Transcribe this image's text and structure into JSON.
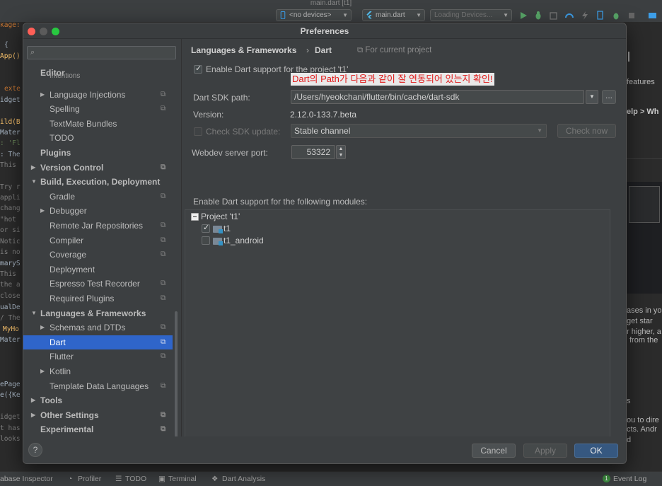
{
  "ide": {
    "window_title": "main.dart [t1]",
    "toolbar": {
      "device_combo": "<no devices>",
      "file_combo": "main.dart",
      "loading_combo": "Loading Devices..."
    },
    "left_code": [
      {
        "text": "kage:",
        "color": "#cc7832"
      },
      {
        "text": "{",
        "color": "#a9b7c6"
      },
      {
        "text": "App()",
        "color": "#ffc66d"
      },
      {
        "text": "exte",
        "color": "#cc7832"
      },
      {
        "text": "idget",
        "color": "#a9b7c6"
      },
      {
        "text": "ild(B",
        "color": "#ffc66d"
      },
      {
        "text": "Mater",
        "color": "#a9b7c6"
      },
      {
        "text": ": 'Fl",
        "color": "#6a8759"
      },
      {
        "text": ": The",
        "color": "#a9b7c6"
      },
      {
        "text": "This",
        "color": "#808080"
      },
      {
        "text": "Try r",
        "color": "#808080"
      },
      {
        "text": "appli",
        "color": "#808080"
      },
      {
        "text": "chang",
        "color": "#808080"
      },
      {
        "text": "\"hot",
        "color": "#808080"
      },
      {
        "text": "or si",
        "color": "#808080"
      },
      {
        "text": "Notic",
        "color": "#808080"
      },
      {
        "text": "is no",
        "color": "#808080"
      },
      {
        "text": "maryS",
        "color": "#a9b7c6"
      },
      {
        "text": "This",
        "color": "#808080"
      },
      {
        "text": "the a",
        "color": "#808080"
      },
      {
        "text": "close",
        "color": "#808080"
      },
      {
        "text": "ualDe",
        "color": "#a9b7c6"
      },
      {
        "text": "/ The",
        "color": "#808080"
      },
      {
        "text": "MyHo",
        "color": "#ffc66d"
      },
      {
        "text": "Mater",
        "color": "#a9b7c6"
      },
      {
        "text": "ePage",
        "color": "#a9b7c6"
      },
      {
        "text": "e({Ke",
        "color": "#a9b7c6"
      },
      {
        "text": "idget",
        "color": "#808080"
      },
      {
        "text": "t has",
        "color": "#808080"
      },
      {
        "text": "looks",
        "color": "#808080"
      }
    ],
    "right_text": [
      "features",
      "elp > Wh",
      "ases in yo",
      "get star",
      "r higher, a",
      "from the",
      "s",
      "ou to dire",
      "cts. Andr",
      "d"
    ],
    "statusbar": {
      "db_inspector": "abase Inspector",
      "profiler": "Profiler",
      "todo": "TODO",
      "terminal": "Terminal",
      "dart_analysis": "Dart Analysis",
      "event_log": "Event Log",
      "event_count": "1"
    }
  },
  "dialog": {
    "title": "Preferences",
    "sidebar": {
      "search_placeholder": "",
      "items": [
        {
          "label": "Editor",
          "indent": 0,
          "bold": true,
          "arrow": "",
          "project": false
        },
        {
          "label": "Intentions",
          "indent": 2,
          "bold": false,
          "arrow": "",
          "project": false
        },
        {
          "label": "Language Injections",
          "indent": 2,
          "bold": false,
          "arrow": "▶",
          "project": true
        },
        {
          "label": "Spelling",
          "indent": 2,
          "bold": false,
          "arrow": "",
          "project": true
        },
        {
          "label": "TextMate Bundles",
          "indent": 2,
          "bold": false,
          "arrow": "",
          "project": false
        },
        {
          "label": "TODO",
          "indent": 2,
          "bold": false,
          "arrow": "",
          "project": false
        },
        {
          "label": "Plugins",
          "indent": 0,
          "bold": true,
          "arrow": "",
          "project": false
        },
        {
          "label": "Version Control",
          "indent": 0,
          "bold": true,
          "arrow": "▶",
          "project": true
        },
        {
          "label": "Build, Execution, Deployment",
          "indent": 0,
          "bold": true,
          "arrow": "▼",
          "project": false
        },
        {
          "label": "Gradle",
          "indent": 2,
          "bold": false,
          "arrow": "",
          "project": true
        },
        {
          "label": "Debugger",
          "indent": 2,
          "bold": false,
          "arrow": "▶",
          "project": false
        },
        {
          "label": "Remote Jar Repositories",
          "indent": 2,
          "bold": false,
          "arrow": "",
          "project": true
        },
        {
          "label": "Compiler",
          "indent": 2,
          "bold": false,
          "arrow": "",
          "project": true
        },
        {
          "label": "Coverage",
          "indent": 2,
          "bold": false,
          "arrow": "",
          "project": true
        },
        {
          "label": "Deployment",
          "indent": 2,
          "bold": false,
          "arrow": "",
          "project": false
        },
        {
          "label": "Espresso Test Recorder",
          "indent": 2,
          "bold": false,
          "arrow": "",
          "project": true
        },
        {
          "label": "Required Plugins",
          "indent": 2,
          "bold": false,
          "arrow": "",
          "project": true
        },
        {
          "label": "Languages & Frameworks",
          "indent": 0,
          "bold": true,
          "arrow": "▼",
          "project": false
        },
        {
          "label": "Schemas and DTDs",
          "indent": 2,
          "bold": false,
          "arrow": "▶",
          "project": true
        },
        {
          "label": "Dart",
          "indent": 2,
          "bold": false,
          "arrow": "",
          "project": true,
          "selected": true
        },
        {
          "label": "Flutter",
          "indent": 2,
          "bold": false,
          "arrow": "",
          "project": true
        },
        {
          "label": "Kotlin",
          "indent": 2,
          "bold": false,
          "arrow": "▶",
          "project": false
        },
        {
          "label": "Template Data Languages",
          "indent": 2,
          "bold": false,
          "arrow": "",
          "project": true
        },
        {
          "label": "Tools",
          "indent": 0,
          "bold": true,
          "arrow": "▶",
          "project": false
        },
        {
          "label": "Other Settings",
          "indent": 0,
          "bold": true,
          "arrow": "▶",
          "project": true
        },
        {
          "label": "Experimental",
          "indent": 0,
          "bold": true,
          "arrow": "",
          "project": true
        }
      ]
    },
    "content": {
      "breadcrumb_parent": "Languages & Frameworks",
      "breadcrumb_sep": "›",
      "breadcrumb_current": "Dart",
      "for_current_project": "For current project",
      "enable_dart_label": "Enable Dart support for the project 't1'",
      "enable_dart_checked": true,
      "annotation": "Dart의 Path가 다음과 같이 잘 연동되어 있는지 확인!",
      "sdk_path_label": "Dart SDK path:",
      "sdk_path_value": "/Users/hyeokchani/flutter/bin/cache/dart-sdk",
      "sdk_browse": "...",
      "version_label": "Version:",
      "version_value": "2.12.0-133.7.beta",
      "check_update_label": "Check SDK update:",
      "check_update_checked": false,
      "channel_value": "Stable channel",
      "check_now": "Check now",
      "webdev_label": "Webdev server port:",
      "webdev_value": "53322",
      "modules_label": "Enable Dart support for the following modules:",
      "project_node": "Project 't1'",
      "modules": [
        {
          "name": "t1",
          "checked": true
        },
        {
          "name": "t1_android",
          "checked": false
        }
      ]
    },
    "footer": {
      "help": "?",
      "cancel": "Cancel",
      "apply": "Apply",
      "ok": "OK"
    }
  },
  "colors": {
    "selection": "#2f65ca",
    "annotation_text": "#e01a1a",
    "primary_button": "#365880",
    "close": "#ff5f57",
    "minimize": "#febc2e",
    "zoom": "#28c840"
  }
}
